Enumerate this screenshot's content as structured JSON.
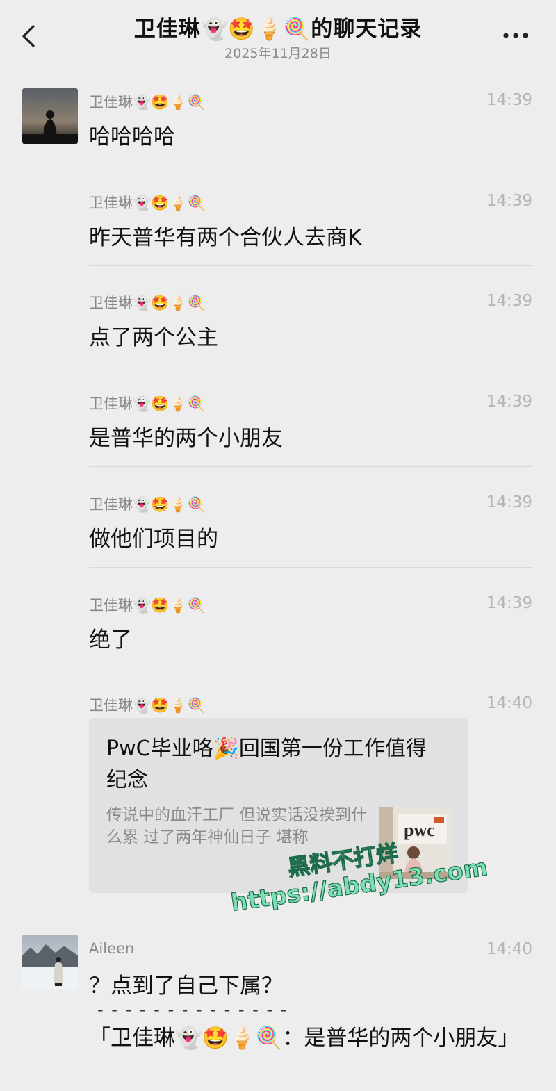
{
  "header": {
    "title": "卫佳琳👻🤩🍦🍭的聊天记录",
    "date": "2025年11月28日"
  },
  "messages": [
    {
      "sender": "卫佳琳👻🤩🍦🍭",
      "time": "14:39",
      "text": "哈哈哈哈"
    },
    {
      "sender": "卫佳琳👻🤩🍦🍭",
      "time": "14:39",
      "text": "昨天普华有两个合伙人去商K"
    },
    {
      "sender": "卫佳琳👻🤩🍦🍭",
      "time": "14:39",
      "text": "点了两个公主"
    },
    {
      "sender": "卫佳琳👻🤩🍦🍭",
      "time": "14:39",
      "text": "是普华的两个小朋友"
    },
    {
      "sender": "卫佳琳👻🤩🍦🍭",
      "time": "14:39",
      "text": "做他们项目的"
    },
    {
      "sender": "卫佳琳👻🤩🍦🍭",
      "time": "14:39",
      "text": "绝了"
    }
  ],
  "card_message": {
    "sender": "卫佳琳👻🤩🍦🍭",
    "time": "14:40",
    "title": "PwC毕业咯🎉回国第一份工作值得纪念",
    "desc": "传说中的血汗工厂 但说实话没挨到什么累 过了两年神仙日子 堪称",
    "thumb_text": "pwc"
  },
  "reply_message": {
    "sender": "Aileen",
    "time": "14:40",
    "text": "？点到了自己下属？",
    "separator": "- - - - - - - - - - - - - -",
    "quote": "「卫佳琳👻🤩🍦🍭：是普华的两个小朋友」"
  },
  "watermark": {
    "line1": "黑料不打烊",
    "line2": "https://abdy13.com"
  },
  "icons": {
    "back": "chevron-left-icon",
    "more": "more-dots-icon"
  }
}
